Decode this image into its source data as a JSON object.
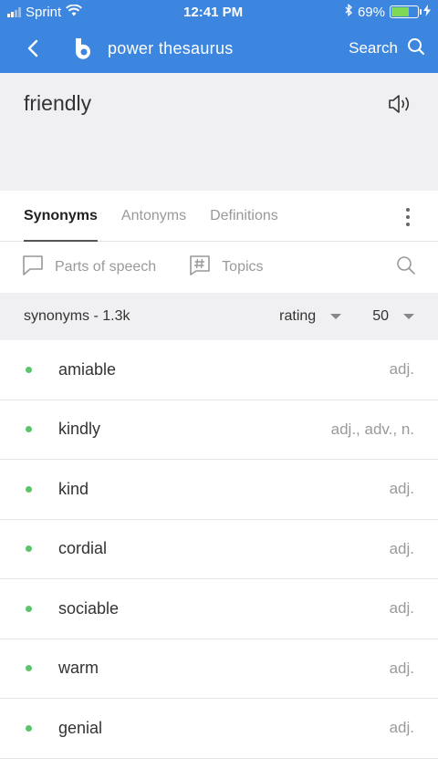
{
  "status_bar": {
    "carrier": "Sprint",
    "time": "12:41 PM",
    "battery": "69%",
    "battery_level": 0.69
  },
  "app_bar": {
    "brand": "power thesaurus",
    "search_label": "Search"
  },
  "word": "friendly",
  "tabs": [
    {
      "label": "Synonyms",
      "active": true
    },
    {
      "label": "Antonyms",
      "active": false
    },
    {
      "label": "Definitions",
      "active": false
    }
  ],
  "filters": {
    "parts_of_speech": "Parts of speech",
    "topics": "Topics"
  },
  "sort_bar": {
    "count_label": "synonyms - 1.3k",
    "sort_value": "rating",
    "page_size": "50"
  },
  "synonyms": [
    {
      "word": "amiable",
      "pos": "adj."
    },
    {
      "word": "kindly",
      "pos": "adj., adv., n."
    },
    {
      "word": "kind",
      "pos": "adj."
    },
    {
      "word": "cordial",
      "pos": "adj."
    },
    {
      "word": "sociable",
      "pos": "adj."
    },
    {
      "word": "warm",
      "pos": "adj."
    },
    {
      "word": "genial",
      "pos": "adj."
    }
  ],
  "colors": {
    "accent": "#3d86e0",
    "dot": "#5cc46a",
    "panel": "#f0f0f2"
  }
}
